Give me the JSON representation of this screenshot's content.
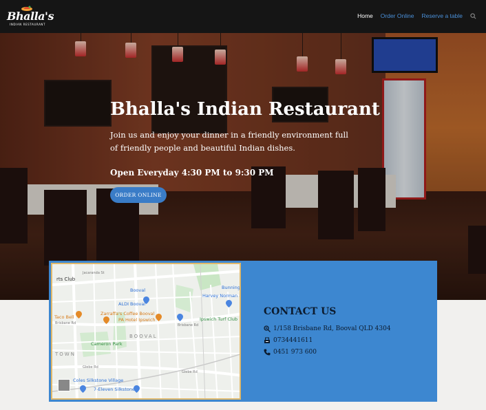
{
  "brand": {
    "name": "Bhalla's",
    "tagline": "INDIAN RESTAURANT",
    "accent": "#3d87d0"
  },
  "nav": {
    "items": [
      {
        "label": "Home",
        "active": true
      },
      {
        "label": "Order Online",
        "active": false
      },
      {
        "label": "Reserve a table",
        "active": false
      }
    ],
    "search_icon": "search-icon"
  },
  "hero": {
    "title": "Bhalla's Indian Restaurant",
    "description": "Join us and enjoy your dinner in a friendly environment full of friendly people and beautiful Indian dishes.",
    "hours": "Open Everyday 4:30 PM to 9:30 PM",
    "cta_label": "ORDER ONLINE"
  },
  "map": {
    "labels": {
      "arts_club": "rts Club",
      "jacaranda": "Jacaranda St",
      "booval_station": "Booval",
      "bunnings": "Bunning",
      "harvey_norman": "Harvey Norman B",
      "aldi": "ALDI Booval",
      "taco_bell": "Taco Bell",
      "zarraffas": "Zarraffa's Coffee Booval",
      "pa_hotel": "PA Hotel Ipswich",
      "turf_club": "Ipswich Turf Club",
      "brisbane_rd": "Brisbane Rd",
      "brisbane_rd_2": "Brisbane Rd",
      "booval_area": "BOOVAL",
      "cameron_park": "Cameron Park",
      "town": "TOWN",
      "glebe_rd": "Glebe Rd",
      "glebe_rd_2": "Glebe Rd",
      "coles": "Coles Silkstone Village",
      "seven_eleven": "7-Eleven Silkstone"
    }
  },
  "contact": {
    "title": "CONTACT US",
    "address": "1/158 Brisbane Rd, Booval QLD 4304",
    "phone1": "0734441611",
    "phone2": "0451 973 600"
  }
}
